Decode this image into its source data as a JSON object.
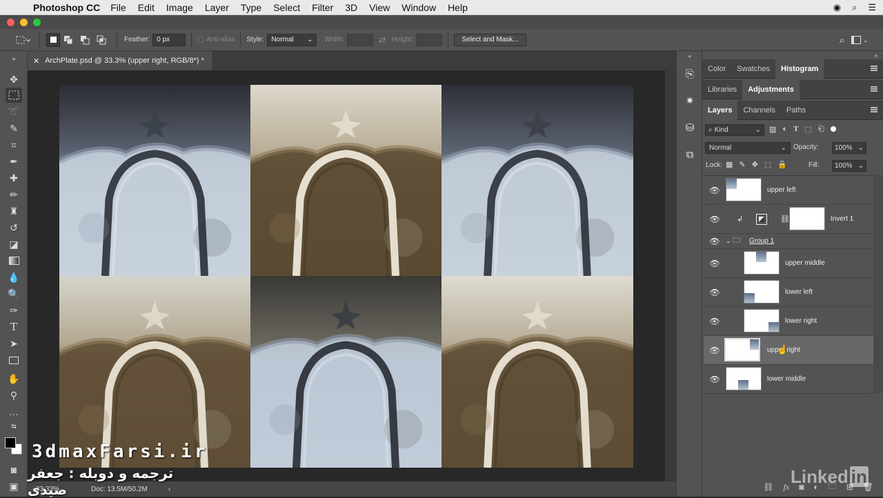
{
  "menubar": {
    "app_name": "Photoshop CC",
    "items": [
      "File",
      "Edit",
      "Image",
      "Layer",
      "Type",
      "Select",
      "Filter",
      "3D",
      "View",
      "Window",
      "Help"
    ]
  },
  "options": {
    "feather_label": "Feather:",
    "feather_value": "0 px",
    "antialias_label": "Anti-alias",
    "style_label": "Style:",
    "style_value": "Normal",
    "width_label": "Width:",
    "height_label": "Height:",
    "select_mask_label": "Select and Mask..."
  },
  "document": {
    "tab_title": "ArchPlate.psd @ 33.3% (upper right, RGB/8*) *",
    "zoom": "33.33%",
    "doc_info": "Doc: 13.5M/50.2M"
  },
  "panels": {
    "top_tabs": [
      "Color",
      "Swatches",
      "Histogram"
    ],
    "top_active": "Histogram",
    "mid_tabs": [
      "Libraries",
      "Adjustments"
    ],
    "mid_active": "Adjustments",
    "layer_tabs": [
      "Layers",
      "Channels",
      "Paths"
    ],
    "layer_active": "Layers",
    "kind_label": "Kind",
    "blend_mode": "Normal",
    "opacity_label": "Opacity:",
    "opacity_value": "100%",
    "lock_label": "Lock:",
    "fill_label": "Fill:",
    "fill_value": "100%"
  },
  "layers": [
    {
      "name": "upper left"
    },
    {
      "name": "Invert 1"
    },
    {
      "name": "Group 1"
    },
    {
      "name": "upper middle"
    },
    {
      "name": "lower left"
    },
    {
      "name": "lower right"
    },
    {
      "name": "upper right"
    },
    {
      "name": "lower middle"
    }
  ],
  "watermarks": {
    "site": "3dmaxFarsi.ir",
    "persian": "ترجمه و دوبله : جعفر صیدی",
    "brand": "Linked",
    "brand_box": "in"
  }
}
